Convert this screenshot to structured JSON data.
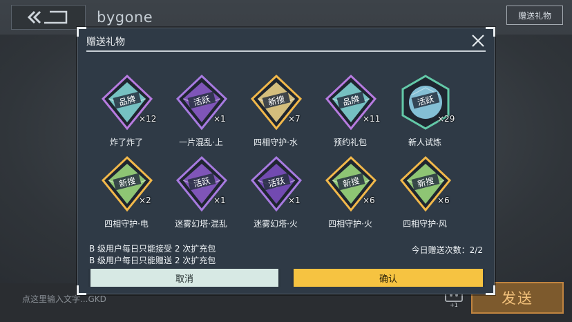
{
  "background": {
    "title": "bygone",
    "gift_button_label": "赠送礼物",
    "chat_placeholder": "点这里输入文字...GKD",
    "send_label": "发送",
    "emoji_badge": "+1"
  },
  "modal": {
    "title": "赠送礼物",
    "items": [
      {
        "label": "炸了炸了",
        "count": "×12",
        "badge": "品牌",
        "frame": "#b77be0",
        "fill": "#7fd3d3",
        "icon": "brand-gem-icon"
      },
      {
        "label": "一片混乱·上",
        "count": "×1",
        "badge": "活跃",
        "frame": "#a77ae0",
        "fill": "#8a5bc8",
        "icon": "active-gem-icon"
      },
      {
        "label": "四相守护·水",
        "count": "×7",
        "badge": "新搜",
        "frame": "#f2b84a",
        "fill": "#e8cf86",
        "icon": "new-gem-icon"
      },
      {
        "label": "预约礼包",
        "count": "×11",
        "badge": "品牌",
        "frame": "#b77be0",
        "fill": "#7fd3d3",
        "icon": "brand-gem-icon"
      },
      {
        "label": "新人试炼",
        "count": "×29",
        "badge": "活跃",
        "frame": "#63c9a8",
        "fill": "#8fd0e8",
        "icon": "active-gem-round-icon"
      },
      {
        "label": "四相守护·电",
        "count": "×2",
        "badge": "新搜",
        "frame": "#f2b84a",
        "fill": "#9ad77c",
        "icon": "new-gem-icon"
      },
      {
        "label": "迷雾幻塔·混乱",
        "count": "×1",
        "badge": "活跃",
        "frame": "#a77ae0",
        "fill": "#8a5bc8",
        "icon": "active-gem-icon"
      },
      {
        "label": "迷雾幻塔·火",
        "count": "×1",
        "badge": "活跃",
        "frame": "#a77ae0",
        "fill": "#7b4fc0",
        "icon": "active-gem-icon"
      },
      {
        "label": "四相守护·火",
        "count": "×6",
        "badge": "新搜",
        "frame": "#f2b84a",
        "fill": "#9ad77c",
        "icon": "new-gem-icon"
      },
      {
        "label": "四相守护·风",
        "count": "×6",
        "badge": "新搜",
        "frame": "#f2b84a",
        "fill": "#9ad77c",
        "icon": "new-gem-icon"
      }
    ],
    "note_receive": "B 级用户每日只能接受 2 次扩充包",
    "note_send": "B 级用户每日只能赠送 2 次扩充包",
    "daily_count": "今日赠送次数：2/2",
    "cancel_label": "取消",
    "confirm_label": "确认"
  }
}
